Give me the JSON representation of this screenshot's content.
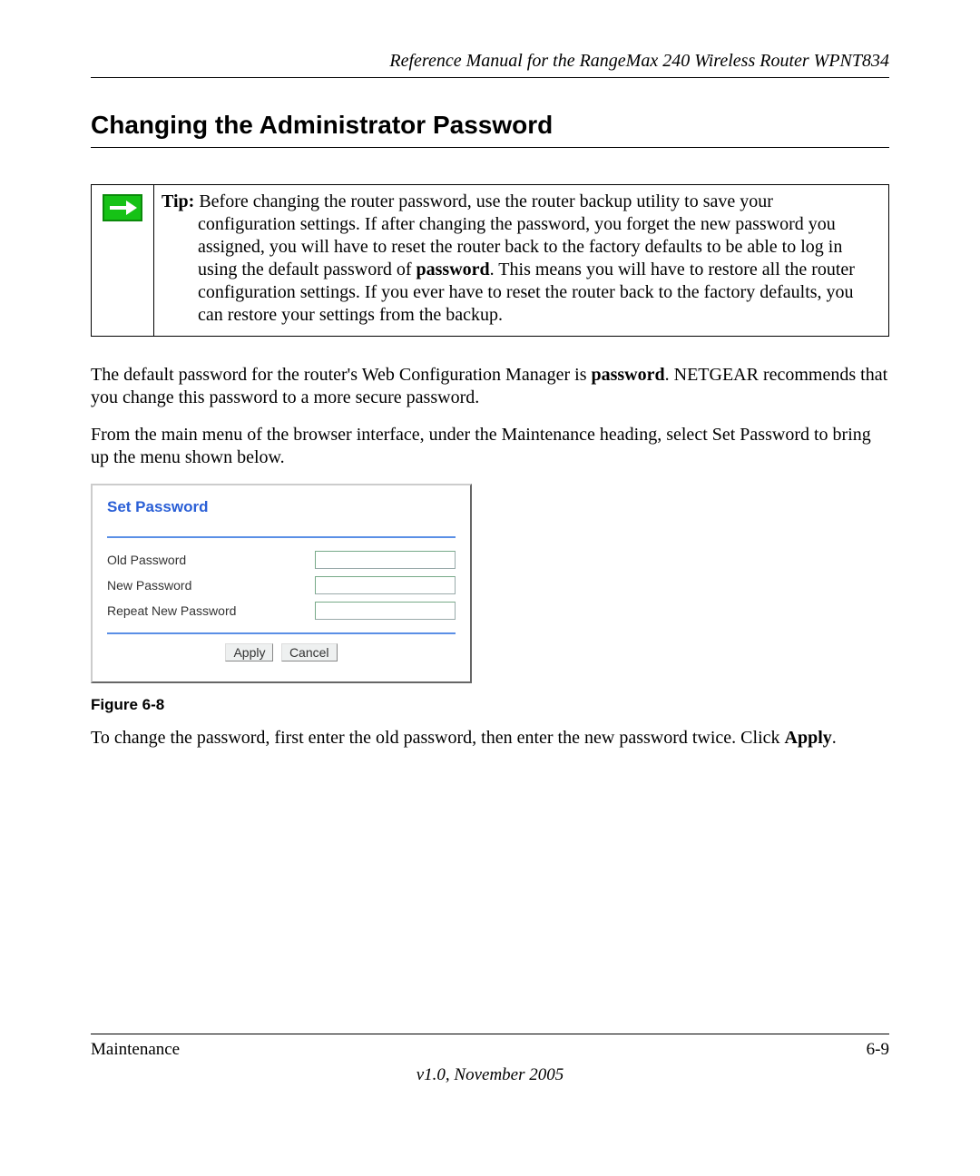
{
  "header": {
    "doc_title": "Reference Manual for the RangeMax 240 Wireless Router WPNT834"
  },
  "section": {
    "heading": "Changing the Administrator Password"
  },
  "tip": {
    "label": "Tip:",
    "line1_after_label": " Before changing the router password, use the router backup utility to save your",
    "rest": "configuration settings. If after changing the password, you forget the new password you assigned, you will have to reset the router back to the factory defaults to be able to log in using the default password of ",
    "bold_word": "password",
    "rest2": ". This means you will have to restore all the router configuration settings. If you ever have to reset the router back to the factory defaults, you can restore your settings from the backup."
  },
  "para1": {
    "pre": "The default password for the router's Web Configuration Manager is ",
    "bold": "password",
    "post": ". NETGEAR recommends that you change this password to a more secure password."
  },
  "para2": "From the main menu of the browser interface, under the Maintenance heading, select Set Password to bring up the menu shown below.",
  "panel": {
    "title": "Set Password",
    "rows": {
      "old": "Old Password",
      "new": "New Password",
      "repeat": "Repeat New Password"
    },
    "buttons": {
      "apply": "Apply",
      "cancel": "Cancel"
    }
  },
  "figure_caption": "Figure 6-8",
  "para3": {
    "pre": "To change the password, first enter the old password, then enter the new password twice. Click ",
    "bold": "Apply",
    "post": "."
  },
  "footer": {
    "left": "Maintenance",
    "right": "6-9",
    "version": "v1.0, November 2005"
  }
}
